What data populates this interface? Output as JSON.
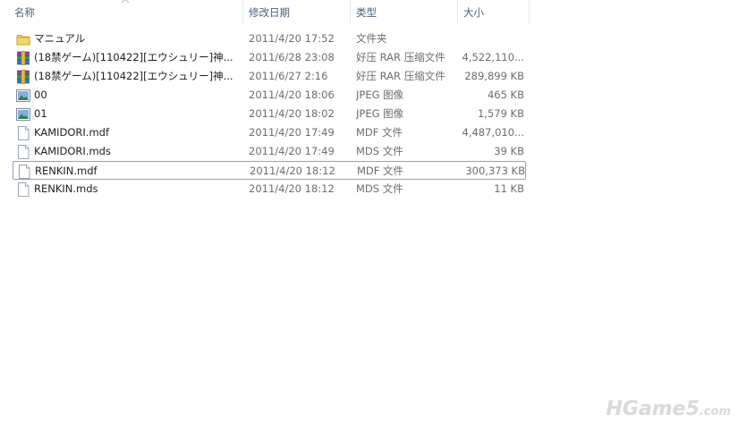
{
  "columns": {
    "name": "名称",
    "date": "修改日期",
    "type": "类型",
    "size": "大小"
  },
  "files": [
    {
      "icon": "folder-icon",
      "name": "マニュアル",
      "date": "2011/4/20 17:52",
      "type": "文件夹",
      "size": ""
    },
    {
      "icon": "rar-archive-icon",
      "name": "(18禁ゲーム)[110422][エウシュリー]神...",
      "date": "2011/6/28 23:08",
      "type": "好压 RAR 压缩文件",
      "size": "4,522,110..."
    },
    {
      "icon": "rar-archive-icon",
      "name": "(18禁ゲーム)[110422][エウシュリー]神...",
      "date": "2011/6/27 2:16",
      "type": "好压 RAR 压缩文件",
      "size": "289,899 KB"
    },
    {
      "icon": "image-file-icon",
      "name": "00",
      "date": "2011/4/20 18:06",
      "type": "JPEG 图像",
      "size": "465 KB"
    },
    {
      "icon": "image-file-icon",
      "name": "01",
      "date": "2011/4/20 18:02",
      "type": "JPEG 图像",
      "size": "1,579 KB"
    },
    {
      "icon": "blank-file-icon",
      "name": "KAMIDORI.mdf",
      "date": "2011/4/20 17:49",
      "type": "MDF 文件",
      "size": "4,487,010..."
    },
    {
      "icon": "blank-file-icon",
      "name": "KAMIDORI.mds",
      "date": "2011/4/20 17:49",
      "type": "MDS 文件",
      "size": "39 KB"
    },
    {
      "icon": "blank-file-icon",
      "name": "RENKIN.mdf",
      "date": "2011/4/20 18:12",
      "type": "MDF 文件",
      "size": "300,373 KB"
    },
    {
      "icon": "blank-file-icon",
      "name": "RENKIN.mds",
      "date": "2011/4/20 18:12",
      "type": "MDS 文件",
      "size": "11 KB"
    }
  ],
  "focused_row": 7,
  "watermark": {
    "main": "HGame5",
    "domain": ".com"
  }
}
